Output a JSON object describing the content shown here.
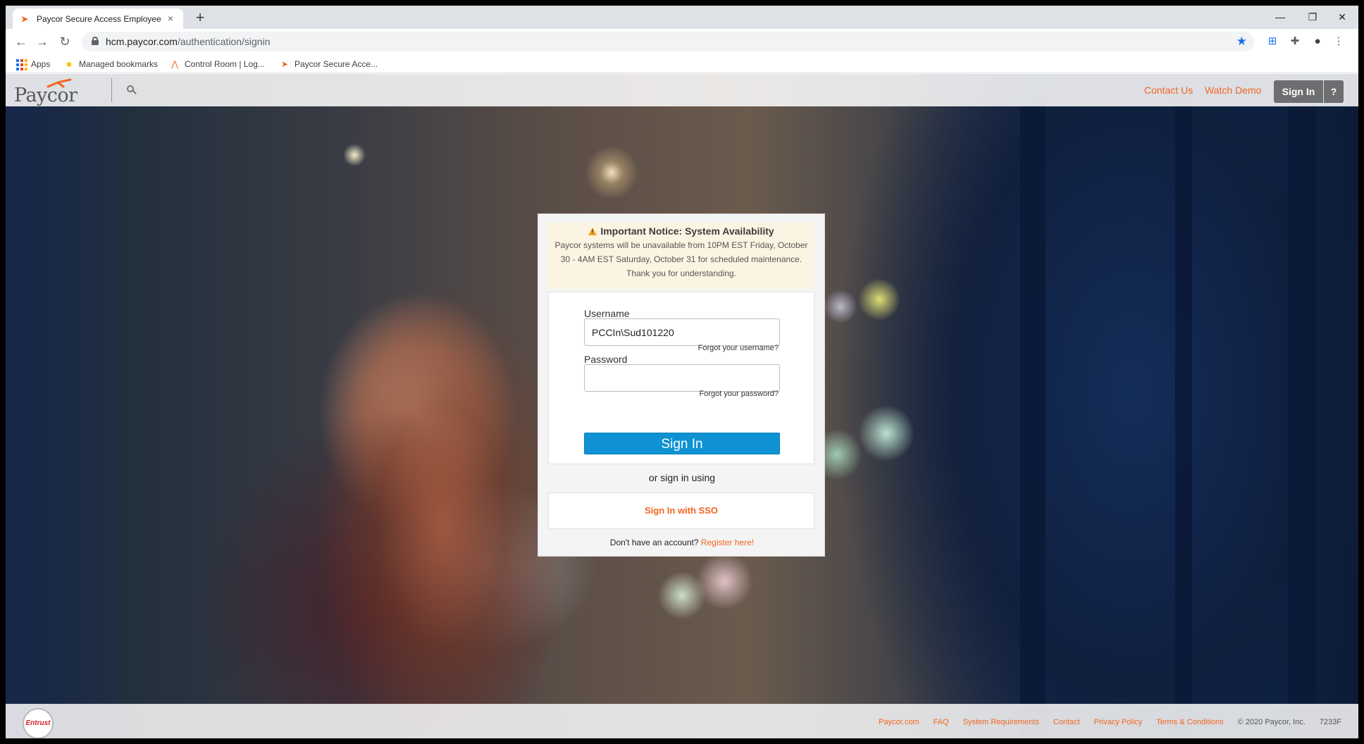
{
  "browser": {
    "tab_title": "Paycor Secure Access Employee",
    "tab_close": "×",
    "new_tab": "+",
    "url_host": "hcm.paycor.com",
    "url_path": "/authentication/signin",
    "window_controls": {
      "minimize": "—",
      "maximize": "❐",
      "close": "✕"
    },
    "nav": {
      "back": "←",
      "forward": "→",
      "reload": "↻"
    },
    "bookmarks": [
      {
        "label": "Apps",
        "icon": "apps-grid-icon"
      },
      {
        "label": "Managed bookmarks",
        "icon": "folder-icon"
      },
      {
        "label": "Control Room | Log...",
        "icon": "automation-anywhere-icon"
      },
      {
        "label": "Paycor Secure Acce...",
        "icon": "paycor-favicon-icon"
      }
    ]
  },
  "header": {
    "logo_text": "Paycor",
    "contact_us": "Contact Us",
    "watch_demo": "Watch Demo",
    "sign_in": "Sign In",
    "help": "?"
  },
  "notice": {
    "title": "Important Notice: System Availability",
    "body": "Paycor systems will be unavailable from 10PM EST Friday, October 30 - 4AM EST Saturday, October 31 for scheduled maintenance. Thank you for understanding."
  },
  "login": {
    "username_label": "Username",
    "username_value": "PCCIn\\Sud101220",
    "forgot_username": "Forgot your username?",
    "password_label": "Password",
    "password_value": "",
    "forgot_password": "Forgot your password?",
    "sign_in_button": "Sign In",
    "or_text": "or sign in using",
    "sso_button": "Sign In with SSO",
    "no_account_text": "Don't have an account?",
    "register_link": "Register here!"
  },
  "footer": {
    "badge_text": "Entrust",
    "links": [
      "Paycor.com",
      "FAQ",
      "System Requirements",
      "Contact",
      "Privacy Policy",
      "Terms & Conditions"
    ],
    "copyright": "© 2020 Paycor, Inc.",
    "version": "7233F"
  },
  "colors": {
    "brand_orange": "#f26522",
    "signin_blue": "#0e92d3",
    "notice_bg": "#fcf4e2"
  }
}
